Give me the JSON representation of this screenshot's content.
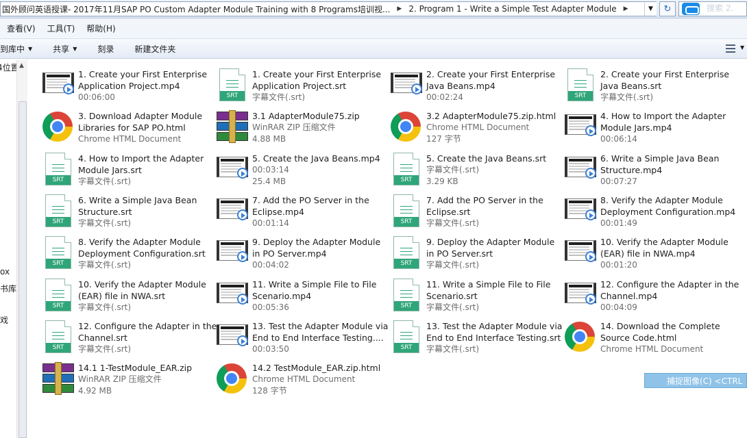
{
  "address": {
    "crumbs": [
      "国外顾问英语授课- 2017年11月SAP PO Custom Adapter Module Training with 8 Programs培训视...",
      "2. Program 1 - Write a Simple Test Adapter Module"
    ],
    "search_ghost": "搜索 2."
  },
  "menu": [
    "查看(V)",
    "工具(T)",
    "帮助(H)"
  ],
  "toolbar": {
    "library": "到库中",
    "share": "共享",
    "burn": "刻录",
    "new_folder": "新建文件夹"
  },
  "nav": {
    "items": [
      "4位置",
      "ox",
      "书库",
      "戏"
    ]
  },
  "files": [
    {
      "type": "video",
      "name": [
        "1. Create your First Enterprise",
        "Application Project.mp4"
      ],
      "meta": [
        "00:06:00"
      ]
    },
    {
      "type": "srt",
      "name": [
        "1. Create your First Enterprise",
        "Application Project.srt"
      ],
      "meta": [
        "字幕文件(.srt)"
      ]
    },
    {
      "type": "video",
      "name": [
        "2. Create your First Enterprise",
        "Java Beans.mp4"
      ],
      "meta": [
        "00:02:24"
      ]
    },
    {
      "type": "srt",
      "name": [
        "2. Create your First Enterprise",
        "Java Beans.srt"
      ],
      "meta": [
        "字幕文件(.srt)"
      ]
    },
    {
      "type": "chrome",
      "name": [
        "3. Download Adapter Module",
        "Libraries for SAP PO.html"
      ],
      "meta": [
        "Chrome HTML Document"
      ]
    },
    {
      "type": "rar",
      "name": [
        "3.1 AdapterModule75.zip"
      ],
      "meta": [
        "WinRAR ZIP 压缩文件",
        "4.88 MB"
      ]
    },
    {
      "type": "chrome",
      "name": [
        "3.2 AdapterModule75.zip.html"
      ],
      "meta": [
        "Chrome HTML Document",
        "127 字节"
      ]
    },
    {
      "type": "video",
      "name": [
        "4. How to Import the Adapter",
        "Module Jars.mp4"
      ],
      "meta": [
        "00:06:14"
      ]
    },
    {
      "type": "srt",
      "name": [
        "4. How to Import the Adapter",
        "Module Jars.srt"
      ],
      "meta": [
        "字幕文件(.srt)"
      ]
    },
    {
      "type": "video",
      "name": [
        "5. Create the Java Beans.mp4"
      ],
      "meta": [
        "00:03:14",
        "25.4 MB"
      ]
    },
    {
      "type": "srt",
      "name": [
        "5. Create the Java Beans.srt"
      ],
      "meta": [
        "字幕文件(.srt)",
        "3.29 KB"
      ]
    },
    {
      "type": "video",
      "name": [
        "6. Write a Simple Java Bean",
        "Structure.mp4"
      ],
      "meta": [
        "00:07:27"
      ]
    },
    {
      "type": "srt",
      "name": [
        "6. Write a Simple Java Bean",
        "Structure.srt"
      ],
      "meta": [
        "字幕文件(.srt)"
      ]
    },
    {
      "type": "video",
      "name": [
        "7. Add the PO Server in the",
        "Eclipse.mp4"
      ],
      "meta": [
        "00:01:14"
      ]
    },
    {
      "type": "srt",
      "name": [
        "7. Add the PO Server in the",
        "Eclipse.srt"
      ],
      "meta": [
        "字幕文件(.srt)"
      ]
    },
    {
      "type": "video",
      "name": [
        "8. Verify the Adapter Module",
        "Deployment Configuration.mp4"
      ],
      "meta": [
        "00:01:49"
      ]
    },
    {
      "type": "srt",
      "name": [
        "8. Verify the Adapter Module",
        "Deployment Configuration.srt"
      ],
      "meta": [
        "字幕文件(.srt)"
      ]
    },
    {
      "type": "video",
      "name": [
        "9. Deploy the Adapter Module",
        "in PO Server.mp4"
      ],
      "meta": [
        "00:04:02"
      ]
    },
    {
      "type": "srt",
      "name": [
        "9. Deploy the Adapter Module",
        "in PO Server.srt"
      ],
      "meta": [
        "字幕文件(.srt)"
      ]
    },
    {
      "type": "video",
      "name": [
        "10. Verify the Adapter Module",
        "(EAR) file in NWA.mp4"
      ],
      "meta": [
        "00:01:20"
      ]
    },
    {
      "type": "srt",
      "name": [
        "10. Verify the Adapter Module",
        "(EAR) file in NWA.srt"
      ],
      "meta": [
        "字幕文件(.srt)"
      ]
    },
    {
      "type": "video",
      "name": [
        "11. Write a Simple File to File",
        "Scenario.mp4"
      ],
      "meta": [
        "00:05:36"
      ]
    },
    {
      "type": "srt",
      "name": [
        "11. Write a Simple File to File",
        "Scenario.srt"
      ],
      "meta": [
        "字幕文件(.srt)"
      ]
    },
    {
      "type": "video",
      "name": [
        "12. Configure the Adapter in the",
        "Channel.mp4"
      ],
      "meta": [
        "00:04:09"
      ]
    },
    {
      "type": "srt",
      "name": [
        "12. Configure the Adapter in the",
        "Channel.srt"
      ],
      "meta": [
        "字幕文件(.srt)"
      ]
    },
    {
      "type": "video",
      "name": [
        "13. Test the Adapter Module via",
        "End to End Interface Testing...."
      ],
      "meta": [
        "00:03:50"
      ]
    },
    {
      "type": "srt",
      "name": [
        "13. Test the Adapter Module via",
        "End to End Interface Testing.srt"
      ],
      "meta": [
        "字幕文件(.srt)"
      ]
    },
    {
      "type": "chrome",
      "name": [
        "14. Download the Complete",
        "Source Code.html"
      ],
      "meta": [
        "Chrome HTML Document"
      ]
    },
    {
      "type": "rar",
      "name": [
        "14.1 1-TestModule_EAR.zip"
      ],
      "meta": [
        "WinRAR ZIP 压缩文件",
        "4.92 MB"
      ]
    },
    {
      "type": "chrome",
      "name": [
        "14.2 TestModule_EAR.zip.html"
      ],
      "meta": [
        "Chrome HTML Document",
        "128 字节"
      ]
    }
  ],
  "capture_tooltip": "捕捉图像(C)    <CTRL"
}
